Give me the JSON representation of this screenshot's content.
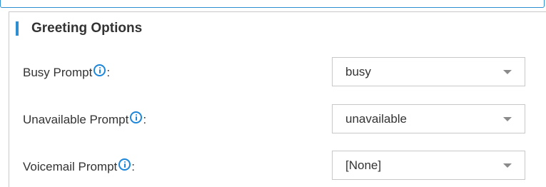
{
  "section": {
    "title": "Greeting Options"
  },
  "fields": [
    {
      "label": "Busy Prompt",
      "colon": ":",
      "value": "busy"
    },
    {
      "label": "Unavailable Prompt",
      "colon": ":",
      "value": "unavailable"
    },
    {
      "label": "Voicemail Prompt",
      "colon": ":",
      "value": "[None]"
    }
  ],
  "icons": {
    "info": "info-circle-icon",
    "dropdown": "chevron-down-icon"
  },
  "colors": {
    "accent": "#2f8ecf",
    "info_icon": "#1e86d8",
    "text": "#333333",
    "border": "#c8c8c8"
  }
}
